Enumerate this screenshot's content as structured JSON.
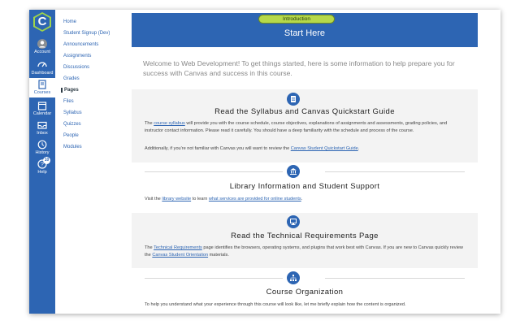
{
  "global_nav": {
    "logo_letter": "C",
    "items": [
      {
        "label": "Account",
        "icon": "account-icon"
      },
      {
        "label": "Dashboard",
        "icon": "dashboard-icon"
      },
      {
        "label": "Courses",
        "icon": "courses-icon"
      },
      {
        "label": "Calendar",
        "icon": "calendar-icon"
      },
      {
        "label": "Inbox",
        "icon": "inbox-icon"
      },
      {
        "label": "History",
        "icon": "history-icon"
      },
      {
        "label": "Help",
        "icon": "help-icon",
        "badge": "10"
      }
    ]
  },
  "course_nav": {
    "items": [
      "Home",
      "Student Signup (Dev)",
      "Announcements",
      "Assignments",
      "Discussions",
      "Grades",
      "Pages",
      "Files",
      "Syllabus",
      "Quizzes",
      "People",
      "Modules"
    ],
    "active": "Pages"
  },
  "banner": {
    "pill": "Introduction",
    "title": "Start Here"
  },
  "welcome": "Welcome to Web Development! To get things started, here is some information to help prepare you for success with Canvas and success in this course.",
  "sections": {
    "s1": {
      "title": "Read the Syllabus and Canvas Quickstart Guide",
      "p1_pre": "The ",
      "p1_link": "course syllabus",
      "p1_post": " will provide you with the course schedule, course objectives, explanations of assignments and assessments, grading policies, and instructor contact information. Please read it carefully. You should have a deep familiarity with the schedule and process of the course.",
      "p2_pre": "Additionally, if you're not familiar with Canvas you will want to review the ",
      "p2_link": "Canvas Student Quickstart Guide",
      "p2_post": "."
    },
    "s2": {
      "title": "Library Information and Student Support",
      "pre": "Visit the ",
      "link1": "library website",
      "mid": " to learn ",
      "link2": "what services are provided for online students",
      "post": "."
    },
    "s3": {
      "title": "Read the Technical Requirements Page",
      "pre": "The ",
      "link1": "Technical Requirements",
      "mid": " page identifies the browsers, operating systems, and plugins that work best with Canvas. If you are new to Canvas quickly review the ",
      "link2": "Canvas Student Orientation",
      "post": " materials."
    },
    "s4": {
      "title": "Course Organization",
      "body": "To help you understand what your experience through this course will look like, let me briefly explain how the content is organized."
    }
  },
  "colors": {
    "brand_blue": "#2d65b3",
    "pill_green": "#b6d94a",
    "shade": "#f3f3f3"
  }
}
